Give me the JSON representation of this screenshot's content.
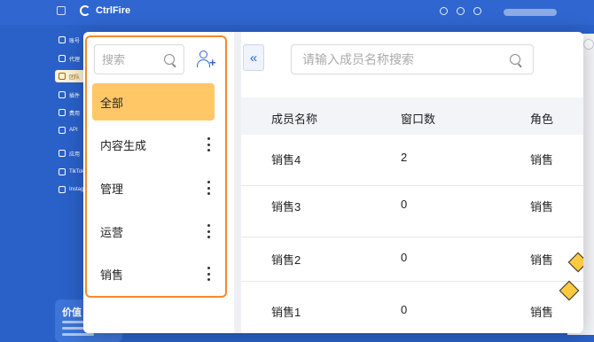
{
  "app": {
    "name": "CtrlFire"
  },
  "sidebar": {
    "items": [
      {
        "label": "账号",
        "icon": "account-icon"
      },
      {
        "label": "代理",
        "icon": "proxy-icon"
      },
      {
        "label": "团队",
        "icon": "team-icon",
        "active": true
      },
      {
        "label": "插件",
        "icon": "plugin-icon"
      },
      {
        "label": "费用",
        "icon": "billing-icon"
      },
      {
        "label": "API",
        "icon": "api-icon"
      }
    ],
    "section_label": "应用",
    "apps": [
      {
        "label": "TikTok"
      },
      {
        "label": "Instagram"
      }
    ],
    "promo_title": "价值"
  },
  "groups_panel": {
    "search_placeholder": "搜索",
    "groups": [
      {
        "label": "全部",
        "active": true
      },
      {
        "label": "内容生成"
      },
      {
        "label": "管理"
      },
      {
        "label": "运营"
      },
      {
        "label": "销售"
      }
    ]
  },
  "members_panel": {
    "search_placeholder": "请输入成员名称搜索",
    "columns": [
      "成员名称",
      "窗口数",
      "角色"
    ],
    "rows": [
      {
        "name": "销售4",
        "windows": "2",
        "role": "销售"
      },
      {
        "name": "销售3",
        "windows": "0",
        "role": "销售"
      },
      {
        "name": "销售2",
        "windows": "0",
        "role": "销售"
      },
      {
        "name": "销售1",
        "windows": "0",
        "role": "销售"
      }
    ]
  },
  "colors": {
    "brand": "#2f66cf",
    "accent_active": "#ffc766",
    "highlight_frame": "#f5892e"
  }
}
